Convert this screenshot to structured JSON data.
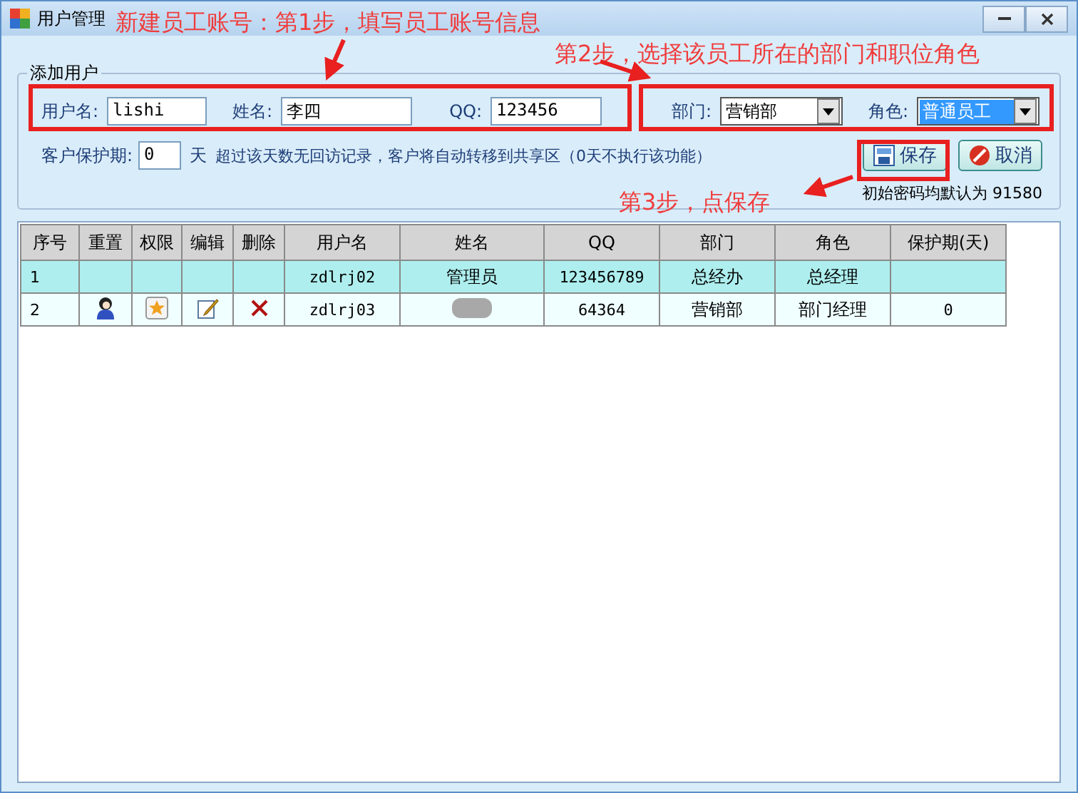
{
  "window": {
    "title": "用户管理"
  },
  "annotations": [
    "新建员工账号：第1步，填写员工账号信息",
    "第2步，选择该员工所在的部门和职位角色",
    "第3步，点保存"
  ],
  "group": {
    "title": "添加用户",
    "fields": [
      {
        "label": "用户名:",
        "value": "lishi"
      },
      {
        "label": "姓名:",
        "value": "李四"
      },
      {
        "label": "QQ:",
        "value": "123456"
      }
    ],
    "selects": [
      {
        "label": "部门:",
        "value": "营销部",
        "focused": false
      },
      {
        "label": "角色:",
        "value": "普通员工",
        "focused": true
      }
    ],
    "protection": {
      "label": "客户保护期:",
      "value": "0",
      "unit": "天",
      "note": "超过该天数无回访记录，客户将自动转移到共享区（0天不执行该功能）"
    },
    "buttons": [
      {
        "label": "保存",
        "kind": "save"
      },
      {
        "label": "取消",
        "kind": "cancel"
      }
    ],
    "password_note": "初始密码均默认为 91580"
  },
  "table": {
    "columns": [
      "序号",
      "重置",
      "权限",
      "编辑",
      "删除",
      "用户名",
      "姓名",
      "QQ",
      "部门",
      "角色",
      "保护期(天)"
    ],
    "rows": [
      {
        "no": "1",
        "actions": false,
        "username": "zdlrj02",
        "name": "管理员",
        "name_blurred": false,
        "qq": "123456789",
        "department": "总经办",
        "role": "总经理",
        "protection": "",
        "selected": true
      },
      {
        "no": "2",
        "actions": true,
        "username": "zdlrj03",
        "name": "",
        "name_blurred": true,
        "qq": "64364",
        "department": "营销部",
        "role": "部门经理",
        "protection": "0",
        "selected": false
      }
    ]
  }
}
